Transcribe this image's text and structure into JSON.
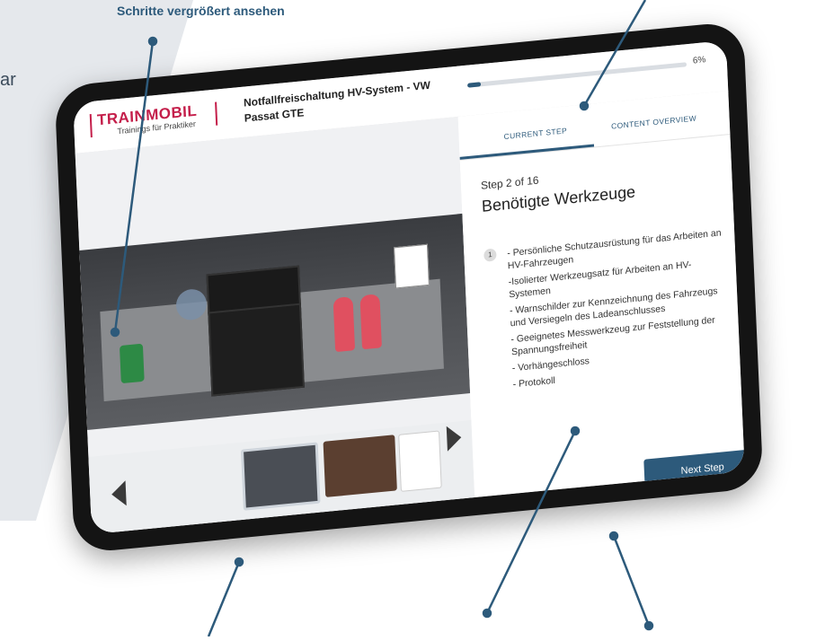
{
  "caption": "Schritte vergrößert ansehen",
  "side_fragment": "ar",
  "app": {
    "logo_title": "TRAINMOBIL",
    "logo_subtitle": "Trainings für Praktiker",
    "course_title": "Notfallfreischaltung HV-System - VW Passat GTE",
    "progress_percent": 6,
    "progress_label": "6%"
  },
  "tabs": {
    "current": "CURRENT STEP",
    "overview": "CONTENT OVERVIEW"
  },
  "step": {
    "counter": "Step 2 of 16",
    "title": "Benötigte Werkzeuge",
    "number": "1",
    "items": [
      "- Persönliche Schutzausrüstung für das Arbeiten an HV-Fahrzeugen",
      "-Isolierter Werkzeugsatz für Arbeiten an HV-Systemen",
      "- Warnschilder zur Kennzeichnung des Fahrzeugs und Versiegeln des Ladeanschlusses",
      "- Geeignetes Messwerkzeug zur Feststellung der Spannungsfreiheit",
      "- Vorhängeschloss",
      "- Protokoll"
    ]
  },
  "nav": {
    "previous": "Previous Step",
    "next": "Next Step"
  },
  "colors": {
    "accent": "#2d5a7b",
    "brand": "#c41e4a"
  }
}
